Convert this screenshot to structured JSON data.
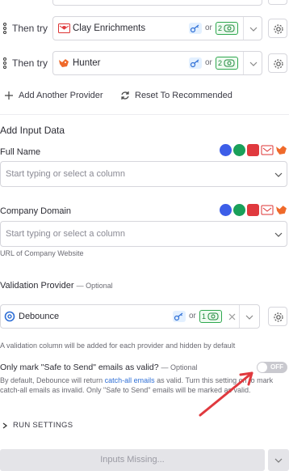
{
  "providers": [
    {
      "prefix": "Then try",
      "name": "Clay Enrichments",
      "or": "or",
      "credits": "2"
    },
    {
      "prefix": "Then try",
      "name": "Hunter",
      "or": "or",
      "credits": "2"
    }
  ],
  "actions": {
    "add_provider": "Add Another Provider",
    "reset": "Reset To Recommended"
  },
  "input_data": {
    "title": "Add Input Data",
    "full_name": {
      "label": "Full Name",
      "placeholder": "Start typing or select a column"
    },
    "company_domain": {
      "label": "Company Domain",
      "placeholder": "Start typing or select a column",
      "helper": "URL of Company Website"
    }
  },
  "validation": {
    "label": "Validation Provider",
    "optional": "— Optional",
    "provider": "Debounce",
    "or": "or",
    "credits": "1",
    "helper": "A validation column will be added for each provider and hidden by default"
  },
  "safe_to_send": {
    "label": "Only mark \"Safe to Send\" emails as valid?",
    "optional": "— Optional",
    "toggle": "OFF",
    "desc_1": "By default, Debounce will return ",
    "desc_link": "catch-all emails",
    "desc_2": " as valid. Turn this setting on to mark catch-all emails as invalid. Only \"Safe to Send\" emails will be marked as valid."
  },
  "run_settings": "RUN SETTINGS",
  "footer": {
    "button": "Inputs Missing..."
  },
  "colors": {
    "accent": "#2f6fd6",
    "credit": "#2fa84f",
    "arrow": "#e0393e"
  }
}
